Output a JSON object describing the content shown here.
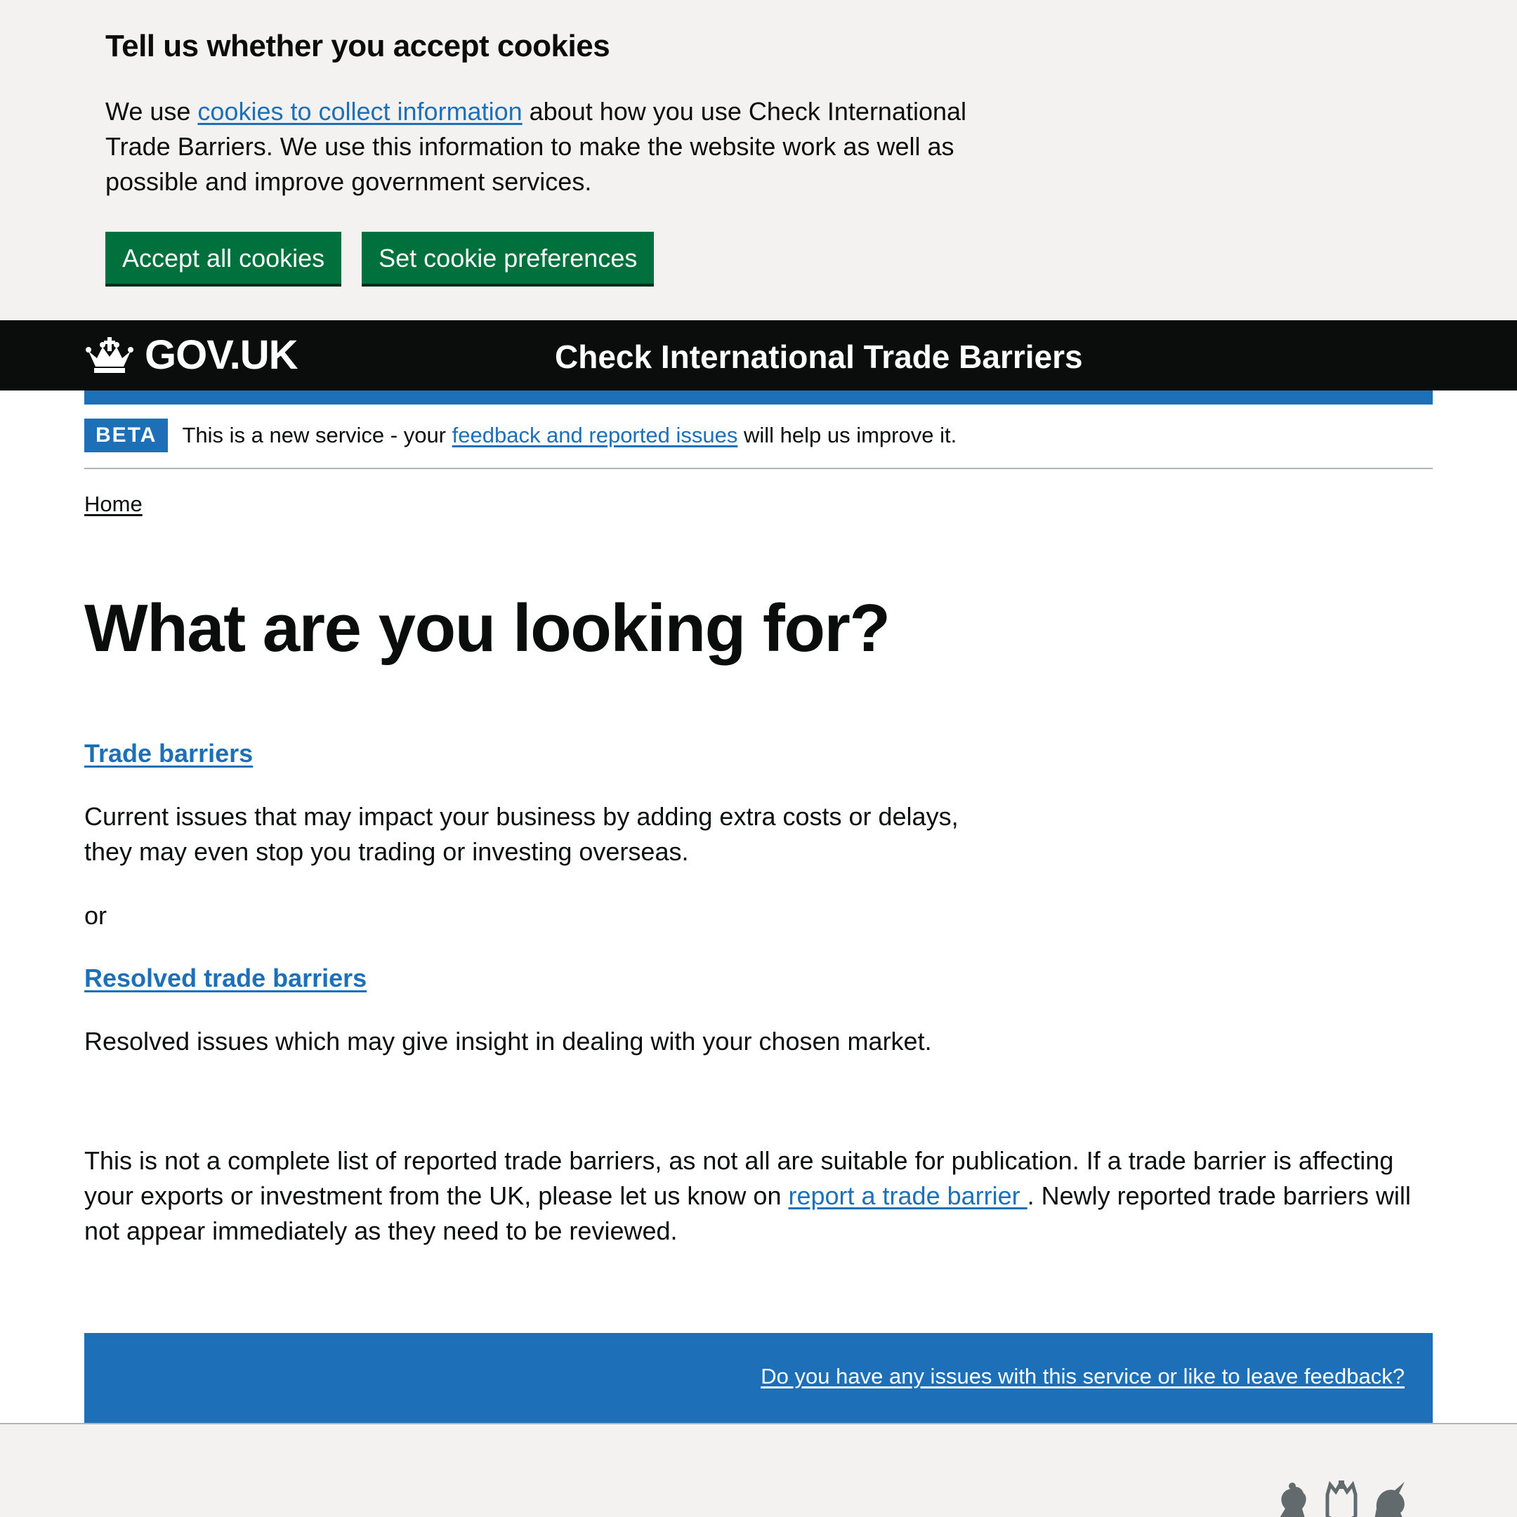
{
  "cookie_banner": {
    "title": "Tell us whether you accept cookies",
    "text_before": "We use ",
    "link": "cookies to collect information",
    "text_after": " about how you use Check International Trade Barriers. We use this information to make the website work as well as possible and improve government services.",
    "accept_label": "Accept all cookies",
    "preferences_label": "Set cookie preferences"
  },
  "header": {
    "logo_text": "GOV.UK",
    "logo_icon": "crown-icon",
    "service_name": "Check International Trade Barriers"
  },
  "phase_banner": {
    "tag": "BETA",
    "text_before": "This is a new service - your ",
    "link": "feedback and reported issues",
    "text_after": " will help us improve it."
  },
  "breadcrumb": {
    "home": "Home"
  },
  "main": {
    "title": "What are you looking for?",
    "trade_barriers_link": "Trade barriers",
    "trade_barriers_desc": "Current issues that may impact your business by adding extra costs or delays, they may even stop you trading or investing overseas.",
    "or": "or",
    "resolved_link": "Resolved trade barriers",
    "resolved_desc": "Resolved issues which may give insight in dealing with your chosen market.",
    "notice_before": "This is not a complete list of reported trade barriers, as not all are suitable for publication. If a trade barrier is affecting your exports or investment from the UK, please let us know on ",
    "notice_link": "report a trade barrier ",
    "notice_after": ". Newly reported trade barriers will not appear immediately as they need to be reviewed."
  },
  "feedback": {
    "link": "Do you have any issues with this service or like to leave feedback?"
  },
  "footer": {
    "crest_icon": "royal-coat-of-arms-icon"
  },
  "colors": {
    "link": "#1d70b8",
    "button": "#00703c",
    "header_bg": "#0b0c0c",
    "banner_bg": "#f3f2f1"
  }
}
